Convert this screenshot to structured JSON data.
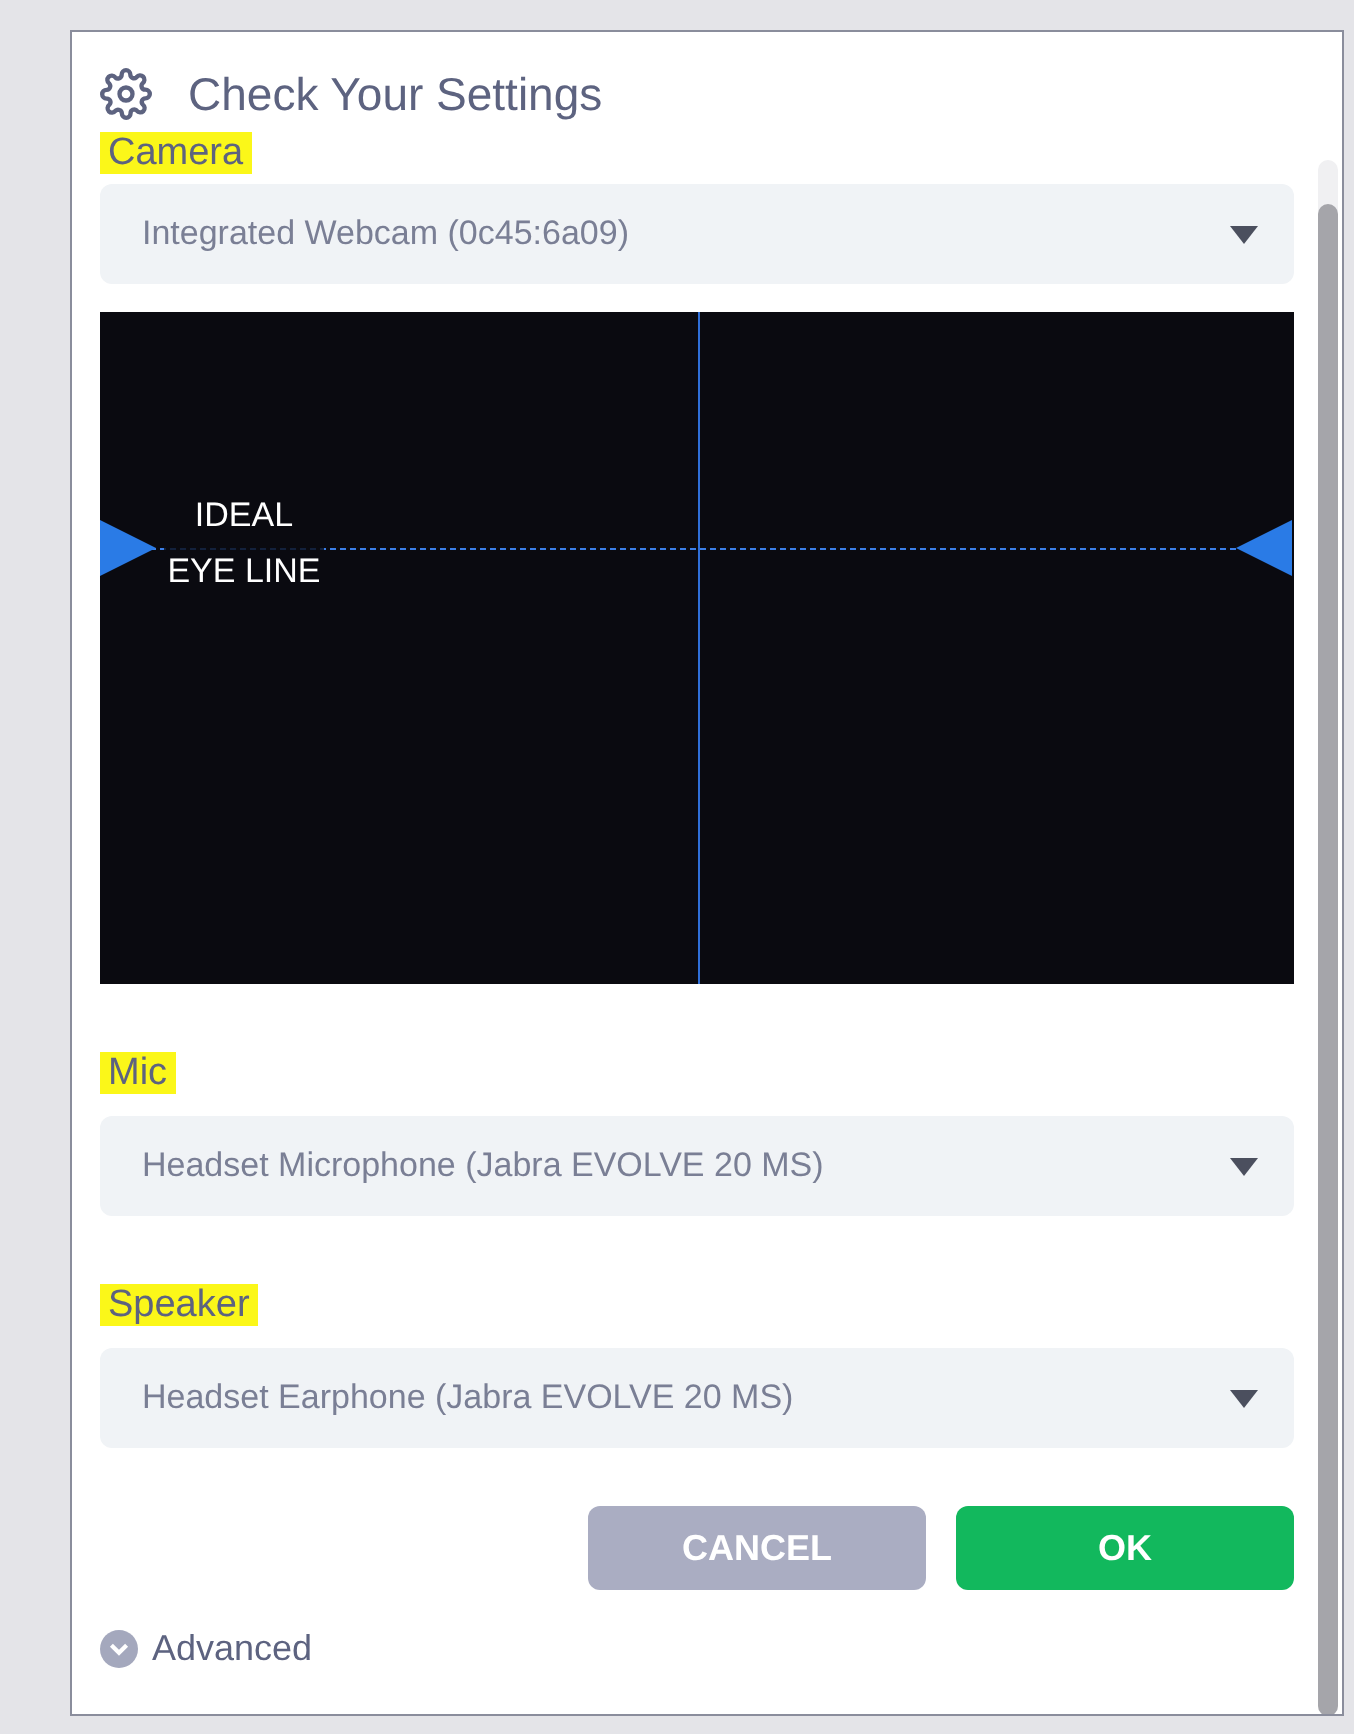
{
  "dialog": {
    "title": "Check Your Settings"
  },
  "fields": [
    {
      "label": "Camera",
      "highlighted": true,
      "value": "Integrated Webcam (0c45:6a09)",
      "kind": "camera"
    },
    {
      "label": "Mic",
      "highlighted": true,
      "value": "Headset Microphone (Jabra EVOLVE 20 MS)",
      "kind": "select"
    },
    {
      "label": "Speaker",
      "highlighted": true,
      "value": "Headset Earphone (Jabra EVOLVE 20 MS)",
      "kind": "select"
    }
  ],
  "preview": {
    "guide_label_1": "IDEAL",
    "guide_label_2": "EYE LINE"
  },
  "buttons": [
    {
      "label": "CANCEL",
      "kind": "secondary"
    },
    {
      "label": "OK",
      "kind": "primary"
    }
  ],
  "advanced": {
    "label": "Advanced",
    "expanded": false
  }
}
